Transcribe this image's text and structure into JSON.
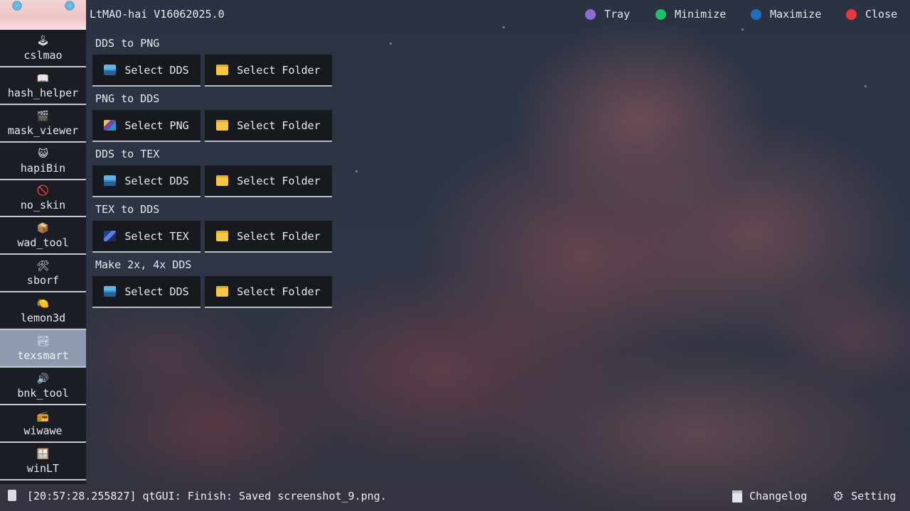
{
  "app": {
    "title": "LtMAO-hai V16062025.0"
  },
  "window_controls": [
    {
      "label": "Tray",
      "color": "#8f6cd1"
    },
    {
      "label": "Minimize",
      "color": "#1fbf6a"
    },
    {
      "label": "Maximize",
      "color": "#1f6fbf"
    },
    {
      "label": "Close",
      "color": "#e53a3f"
    }
  ],
  "sidebar": {
    "items": [
      {
        "label": "cslmao",
        "icon": "joystick-icon",
        "glyph": "🕹"
      },
      {
        "label": "hash_helper",
        "icon": "book-icon",
        "glyph": "📖"
      },
      {
        "label": "mask_viewer",
        "icon": "clapper-icon",
        "glyph": "🎬"
      },
      {
        "label": "hapiBin",
        "icon": "cat-icon",
        "glyph": "😺"
      },
      {
        "label": "no_skin",
        "icon": "prohibited-icon",
        "glyph": "🚫"
      },
      {
        "label": "wad_tool",
        "icon": "package-icon",
        "glyph": "📦"
      },
      {
        "label": "sborf",
        "icon": "tools-icon",
        "glyph": "🛠"
      },
      {
        "label": "lemon3d",
        "icon": "lemon-icon",
        "glyph": "🍋"
      },
      {
        "label": "texsmart",
        "icon": "picture-icon",
        "glyph": "🏞",
        "active": true
      },
      {
        "label": "bnk_tool",
        "icon": "speaker-icon",
        "glyph": "🔊"
      },
      {
        "label": "wiwawe",
        "icon": "radio-icon",
        "glyph": "📻"
      },
      {
        "label": "winLT",
        "icon": "windows-icon",
        "glyph": "🪟"
      }
    ]
  },
  "sections": [
    {
      "title": "DDS to PNG",
      "select_label": "Select DDS",
      "select_icon": "dds-image-icon",
      "folder_label": "Select Folder"
    },
    {
      "title": "PNG to DDS",
      "select_label": "Select PNG",
      "select_icon": "png-image-icon",
      "folder_label": "Select Folder"
    },
    {
      "title": "DDS to TEX",
      "select_label": "Select DDS",
      "select_icon": "dds-image-icon",
      "folder_label": "Select Folder"
    },
    {
      "title": "TEX to DDS",
      "select_label": "Select TEX",
      "select_icon": "tex-image-icon",
      "folder_label": "Select Folder"
    },
    {
      "title": "Make 2x, 4x DDS",
      "select_label": "Select DDS",
      "select_icon": "dds-image-icon",
      "folder_label": "Select Folder"
    }
  ],
  "status": {
    "log": "[20:57:28.255827] qtGUI: Finish: Saved screenshot_9.png.",
    "changelog_label": "Changelog",
    "setting_label": "Setting"
  }
}
